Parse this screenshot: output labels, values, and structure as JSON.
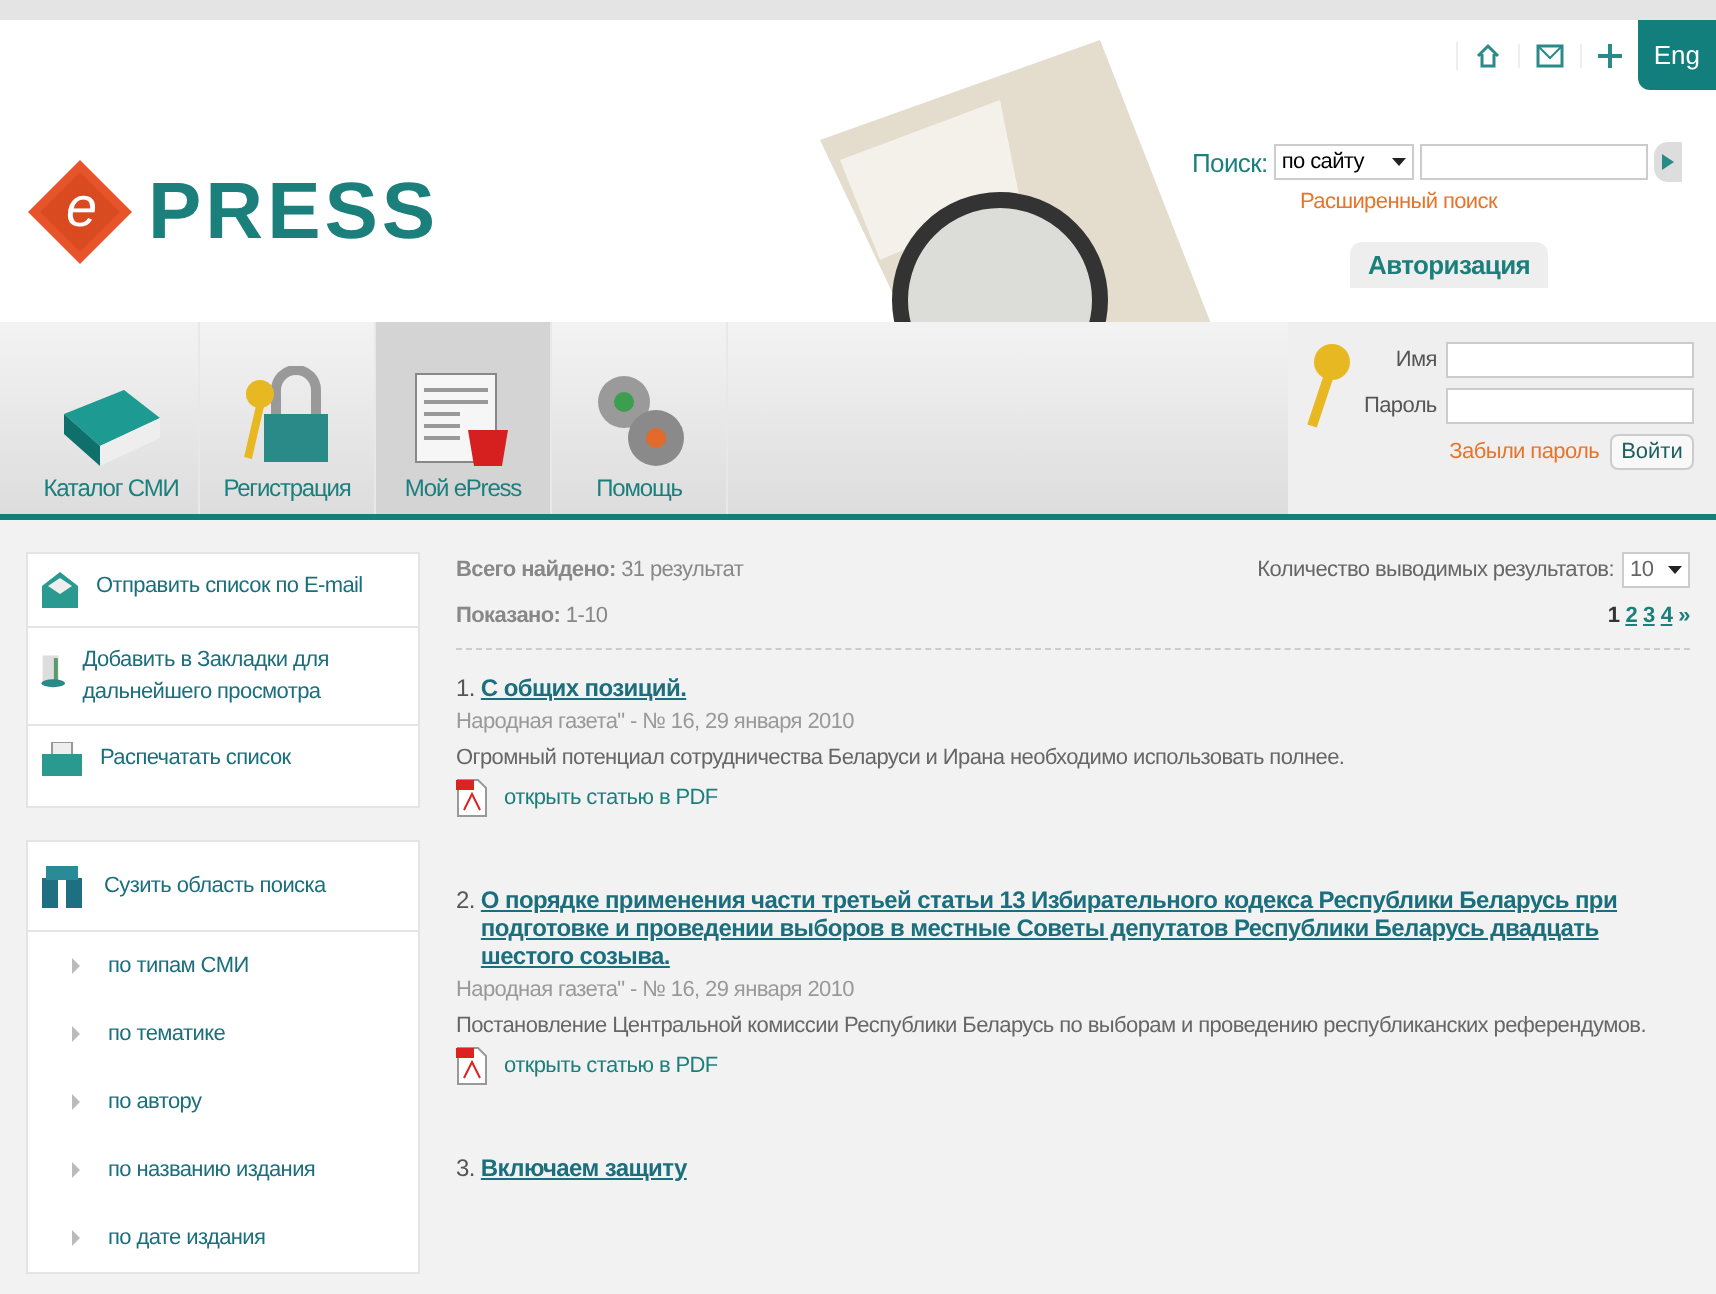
{
  "language_button": "Eng",
  "logo": {
    "letter": "e",
    "text": "PRESS"
  },
  "nav": [
    {
      "label": "Каталог СМИ",
      "kind": "book",
      "selected": false
    },
    {
      "label": "Регистрация",
      "kind": "lock",
      "selected": false
    },
    {
      "label": "Мой ePress",
      "kind": "news",
      "selected": true
    },
    {
      "label": "Помощь",
      "kind": "gears",
      "selected": false
    }
  ],
  "search": {
    "label": "Поиск:",
    "scope": "по сайту",
    "advanced_link": "Расширенный поиск"
  },
  "auth": {
    "title": "Авторизация",
    "name_label": "Имя",
    "password_label": "Пароль",
    "forgot_link": "Забыли пароль",
    "submit": "Войти"
  },
  "actions": [
    {
      "label": "Отправить список по E-mail",
      "kind": "email"
    },
    {
      "label": "Добавить в Закладки для дальнейшего просмотра",
      "kind": "bookmark"
    },
    {
      "label": "Распечатать список",
      "kind": "print"
    }
  ],
  "narrow": {
    "title": "Сузить область поиска",
    "items": [
      "по типам СМИ",
      "по тематике",
      "по автору",
      "по названию издания",
      "по дате издания"
    ]
  },
  "results": {
    "found_label": "Всего найдено:",
    "found_value": "31 результат",
    "shown_label": "Показано:",
    "shown_value": "1-10",
    "per_page_label": "Количество выводимых результатов:",
    "per_page": "10",
    "pages": [
      {
        "label": "1",
        "selected": true
      },
      {
        "label": "2",
        "selected": false
      },
      {
        "label": "3",
        "selected": false
      },
      {
        "label": "4",
        "selected": false
      }
    ],
    "next": "»",
    "items": [
      {
        "number": "1.",
        "title": "С общих позиций.",
        "source": "Народная газета\" - № 16, 29 января 2010",
        "summary": "Огромный потенциал сотрудничества Беларуси и Ирана необходимо использовать полнее.",
        "pdf_link": "открыть статью в PDF"
      },
      {
        "number": "2.",
        "title": "О порядке применения части третьей статьи 13 Избирательного кодекса Республики Беларусь при подготовке и проведении выборов в местные Советы депутатов Республики Беларусь двадцать шестого созыва.",
        "source": "Народная газета\" - № 16, 29 января 2010",
        "summary": "Постановление Центральной комиссии Республики Беларусь по выборам и проведению республиканских референдумов.",
        "pdf_link": "открыть статью в PDF"
      },
      {
        "number": "3.",
        "title": "Включаем защиту"
      }
    ]
  }
}
